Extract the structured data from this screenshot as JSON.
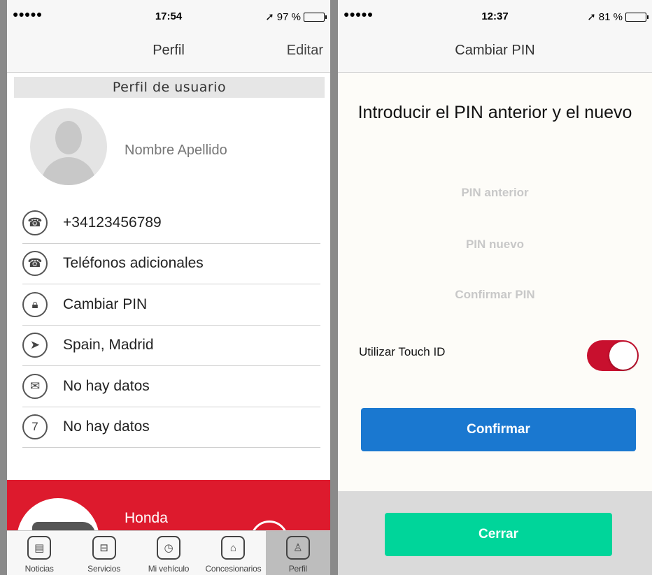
{
  "left": {
    "status": {
      "signal": "●●●●●",
      "time": "17:54",
      "battery_text": "97 %",
      "battery_level": 0.97
    },
    "nav": {
      "title": "Perfil",
      "edit_label": "Editar"
    },
    "section_title": "Perfil de usuario",
    "user_name": "Nombre Apellido",
    "items": [
      {
        "icon": "phonebook-icon",
        "glyph": "☎",
        "text": "+34123456789"
      },
      {
        "icon": "phonebook-icon",
        "glyph": "☎",
        "text": "Teléfonos adicionales"
      },
      {
        "icon": "lock-icon",
        "glyph": "🔒︎",
        "text": "Cambiar PIN"
      },
      {
        "icon": "location-arrow-icon",
        "glyph": "➤",
        "text": "Spain, Madrid"
      },
      {
        "icon": "envelope-icon",
        "glyph": "✉",
        "text": "No hay datos"
      },
      {
        "icon": "calendar-icon",
        "glyph": "7",
        "text": "No hay datos"
      }
    ],
    "car": {
      "name": "Honda"
    },
    "tabs": [
      {
        "label": "Noticias",
        "icon": "newspaper-icon",
        "glyph": "▤",
        "active": false
      },
      {
        "label": "Servicios",
        "icon": "briefcase-icon",
        "glyph": "⊟",
        "active": false
      },
      {
        "label": "Mi vehículo",
        "icon": "car-clock-icon",
        "glyph": "◷",
        "active": false
      },
      {
        "label": "Concesionarios",
        "icon": "dealer-home-icon",
        "glyph": "⌂",
        "active": false
      },
      {
        "label": "Perfil",
        "icon": "user-profile-icon",
        "glyph": "♙",
        "active": true
      }
    ]
  },
  "right": {
    "status": {
      "signal": "●●●●●",
      "time": "12:37",
      "battery_text": "81 %",
      "battery_level": 0.81
    },
    "nav": {
      "title": "Cambiar PIN"
    },
    "heading": "Introducir el PIN anterior y el nuevo",
    "fields": {
      "old_pin": "PIN anterior",
      "new_pin": "PIN nuevo",
      "confirm_pin": "Confirmar PIN"
    },
    "touch_id_label": "Utilizar Touch ID",
    "touch_id_on": true,
    "confirm_label": "Confirmar",
    "close_label": "Cerrar"
  },
  "colors": {
    "red": "#dd1a2d",
    "toggle": "#c8102e",
    "confirm_blue": "#1a78d0",
    "close_green": "#00d59a"
  }
}
